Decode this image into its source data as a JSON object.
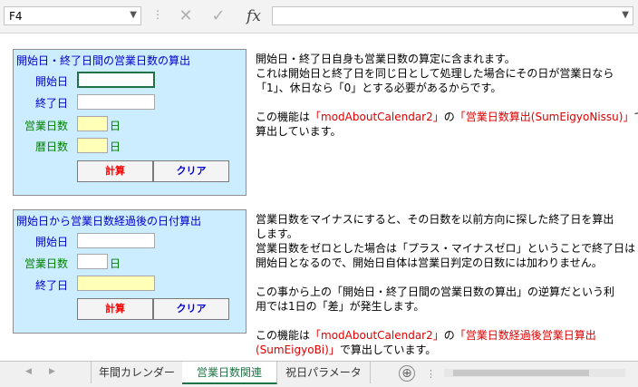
{
  "formula_bar": {
    "name_box": "F4",
    "cancel_icon": "✕",
    "enter_icon": "✓",
    "fx_label": "fx",
    "formula_value": ""
  },
  "panel1": {
    "title": "開始日・終了日間の営業日数の算出",
    "start_label": "開始日",
    "end_label": "終了日",
    "bizdays_label": "営業日数",
    "caldays_label": "暦日数",
    "unit1": "日",
    "unit2": "日",
    "calc_button": "計算",
    "clear_button": "クリア"
  },
  "panel2": {
    "title": "開始日から営業日数経過後の日付算出",
    "start_label": "開始日",
    "bizdays_label": "営業日数",
    "end_label": "終了日",
    "unit": "日",
    "calc_button": "計算",
    "clear_button": "クリア"
  },
  "text1": {
    "line1": "開始日・終了日自身も営業日数の算定に含まれます。",
    "line2": "これは開始日と終了日を同じ日として処理した場合にその日が営業日なら",
    "line3": "「1」、休日なら「0」とする必要があるからです。",
    "line4_a": "この機能は",
    "line4_b": "「modAboutCalendar2」",
    "line4_c": "の",
    "line4_d": "「営業日数算出(SumEigyoNissu)」",
    "line4_e": "で",
    "line5": "算出しています。"
  },
  "text2": {
    "line1": "営業日数をマイナスにすると、その日数を以前方向に探した終了日を算出",
    "line2": "します。",
    "line3": "営業日数をゼロとした場合は「プラス・マイナスゼロ」ということで終了日は",
    "line4": "開始日となるので、開始日自体は営業日判定の日数には加わりません。",
    "line5": "この事から上の「開始日・終了日間の営業日数の算出」の逆算だという利",
    "line6": "用では1日の「差」が発生します。",
    "line7_a": "この機能は",
    "line7_b": "「modAboutCalendar2」",
    "line7_c": "の",
    "line7_d": "「営業日数経過後営業日算出",
    "line8_a": "(SumEigyoBi)」",
    "line8_b": "で算出しています。"
  },
  "sheet_tabs": {
    "tab1": "年間カレンダー",
    "tab2": "営業日数関連",
    "tab3": "祝日パラメータ",
    "add_icon": "⊕",
    "more": "⋮"
  },
  "colors": {
    "panel_bg": "#ccecff",
    "title_blue": "#0000cc",
    "label_green": "#008000",
    "highlight_red": "#e00000",
    "yellow_cell": "#ffffb7",
    "excel_green": "#217346"
  }
}
